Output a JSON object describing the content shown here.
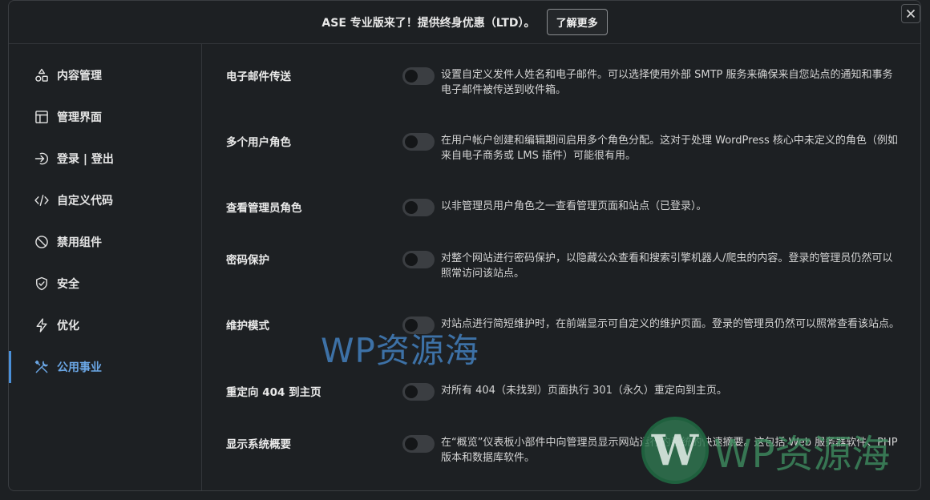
{
  "banner": {
    "text": "ASE 专业版来了！提供终身优惠（LTD）。",
    "button_label": "了解更多"
  },
  "close_label": "×",
  "sidebar": {
    "items": [
      {
        "label": "内容管理",
        "icon": "shapes-icon",
        "active": false
      },
      {
        "label": "管理界面",
        "icon": "layout-icon",
        "active": false
      },
      {
        "label": "登录 | 登出",
        "icon": "login-icon",
        "active": false
      },
      {
        "label": "自定义代码",
        "icon": "code-icon",
        "active": false
      },
      {
        "label": "禁用组件",
        "icon": "ban-icon",
        "active": false
      },
      {
        "label": "安全",
        "icon": "shield-icon",
        "active": false
      },
      {
        "label": "优化",
        "icon": "bolt-icon",
        "active": false
      },
      {
        "label": "公用事业",
        "icon": "tools-icon",
        "active": true
      }
    ]
  },
  "settings": [
    {
      "title": "电子邮件传送",
      "enabled": false,
      "description": "设置自定义发件人姓名和电子邮件。可以选择使用外部 SMTP 服务来确保来自您站点的通知和事务电子邮件被传送到收件箱。"
    },
    {
      "title": "多个用户角色",
      "enabled": false,
      "description": "在用户帐户创建和编辑期间启用多个角色分配。这对于处理 WordPress 核心中未定义的角色（例如来自电子商务或 LMS 插件）可能很有用。"
    },
    {
      "title": "查看管理员角色",
      "enabled": false,
      "description": "以非管理员用户角色之一查看管理页面和站点（已登录）。"
    },
    {
      "title": "密码保护",
      "enabled": false,
      "description": "对整个网站进行密码保护，以隐藏公众查看和搜索引擎机器人/爬虫的内容。登录的管理员仍然可以照常访问该站点。"
    },
    {
      "title": "维护模式",
      "enabled": false,
      "description": "对站点进行简短维护时，在前端显示可自定义的维护页面。登录的管理员仍然可以照常查看该站点。"
    },
    {
      "title": "重定向 404 到主页",
      "enabled": false,
      "description": "对所有 404（未找到）页面执行 301（永久）重定向到主页。"
    },
    {
      "title": "显示系统概要",
      "enabled": false,
      "description": "在“概览”仪表板小部件中向管理员显示网站运行的系统的快速摘要。这包括 Web 服务器软件、PHP 版本和数据库软件。"
    }
  ],
  "watermark": {
    "center_text": "WP资源海",
    "logo_letter": "W",
    "corner_text": "WP资源海"
  },
  "colors": {
    "accent": "#6ba7e6",
    "background": "#1d2023",
    "toggle_off": "#3b3e42"
  }
}
